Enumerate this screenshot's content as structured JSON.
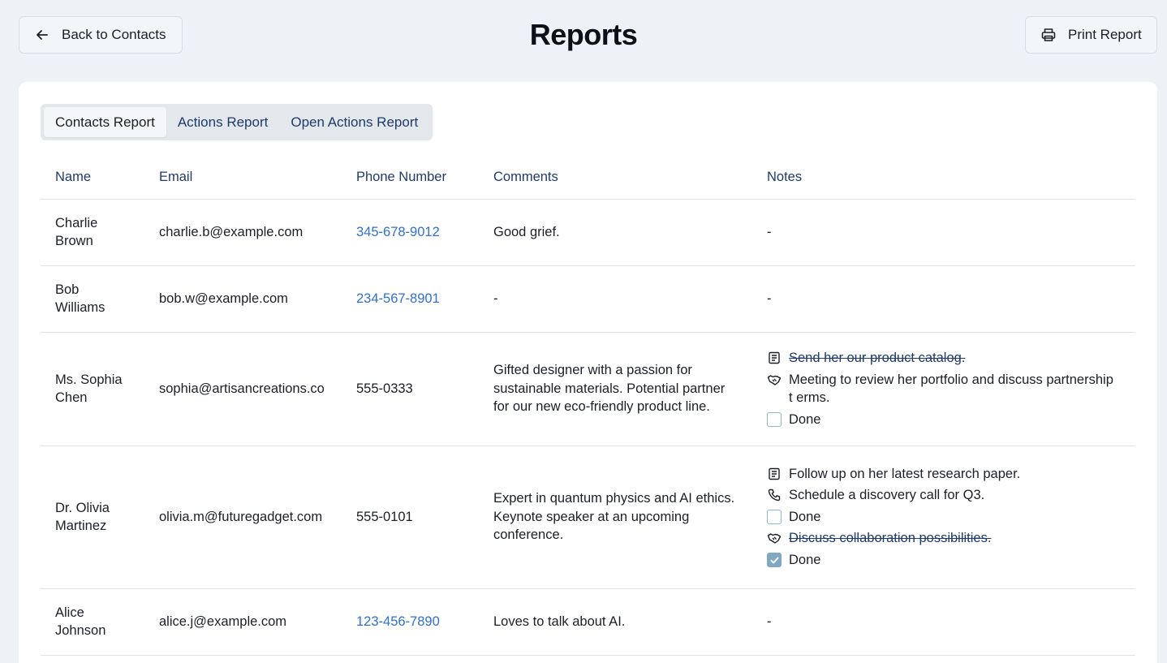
{
  "header": {
    "back_label": "Back to Contacts",
    "title": "Reports",
    "print_label": "Print Report"
  },
  "tabs": [
    {
      "label": "Contacts Report",
      "active": true
    },
    {
      "label": "Actions Report",
      "active": false
    },
    {
      "label": "Open Actions Report",
      "active": false
    }
  ],
  "table": {
    "columns": [
      "Name",
      "Email",
      "Phone Number",
      "Comments",
      "Notes"
    ],
    "rows": [
      {
        "name_line1": "Charlie",
        "name_line2": "Brown",
        "email": "charlie.b@example.com",
        "phone": "345-678-9012",
        "comments": "Good grief.",
        "notes": "-"
      },
      {
        "name_line1": "Bob",
        "name_line2": "Williams",
        "email": "bob.w@example.com",
        "phone": "234-567-8901",
        "comments": "-",
        "notes": "-"
      },
      {
        "name_line1": "Ms. Sophia",
        "name_line2": "Chen",
        "email": "sophia@artisancreations.co",
        "phone": "555-0333",
        "comments": "Gifted designer with a passion for sustainable materials. Potential partner for our new eco-friendly product line.",
        "actions": [
          {
            "icon": "notepad-icon",
            "text": "Send her our product catalog.",
            "completed": true
          },
          {
            "icon": "handshake-icon",
            "text": "Meeting to review her portfolio and discuss partnership t erms.",
            "completed": false,
            "done_label": "Done"
          }
        ]
      },
      {
        "name_line1": "Dr. Olivia",
        "name_line2": "Martinez",
        "email": "olivia.m@futuregadget.com",
        "phone": "555-0101",
        "comments": "Expert in quantum physics and AI ethics. Keynote speaker at an upcoming conference.",
        "actions": [
          {
            "icon": "notepad-icon",
            "text": "Follow up on her latest research paper.",
            "completed": false
          },
          {
            "icon": "phone-icon",
            "text": "Schedule a discovery call for Q3.",
            "completed": false,
            "done_label": "Done"
          },
          {
            "icon": "handshake-icon",
            "text": "Discuss collaboration possibilities.",
            "completed": true,
            "done_label": "Done"
          }
        ]
      },
      {
        "name_line1": "Alice",
        "name_line2": "Johnson",
        "email": "alice.j@example.com",
        "phone": "123-456-7890",
        "comments": "Loves to talk about AI.",
        "notes": "-"
      }
    ]
  },
  "colors": {
    "background": "#eef2f6",
    "link": "#2f6fd6",
    "header_text": "#1f3a6b",
    "checkbox_checked": "#7ea8c3"
  }
}
